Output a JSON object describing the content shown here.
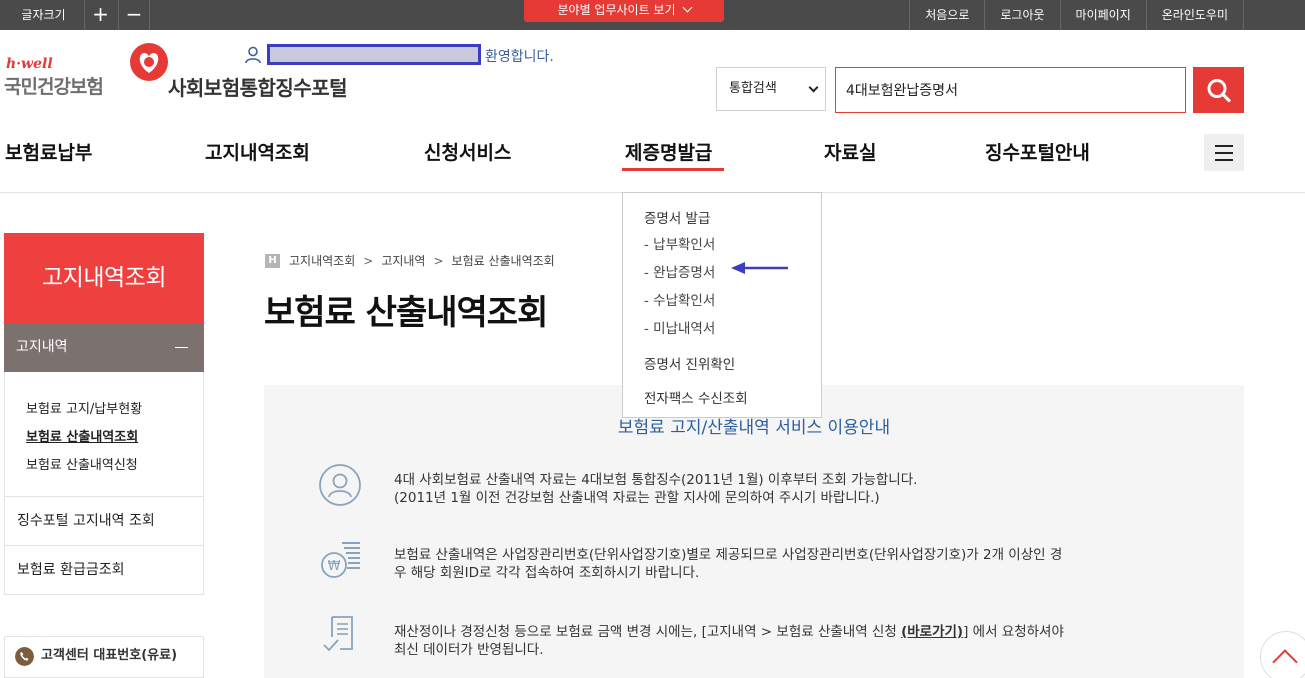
{
  "topbar": {
    "font_size_label": "글자크기",
    "font_plus": "+",
    "font_minus": "−",
    "field_site_label": "분야별 업무사이트 보기",
    "links": [
      "처음으로",
      "로그아웃",
      "마이페이지",
      "온라인도우미"
    ]
  },
  "header": {
    "logo_hwell": "h·well",
    "logo_main": "국민건강보험",
    "portal_title": "사회보험통합징수포털",
    "welcome": "환영합니다.",
    "search_select": "통합검색",
    "search_value": "4대보험완납증명서"
  },
  "gnb": [
    "보험료납부",
    "고지내역조회",
    "신청서비스",
    "제증명발급",
    "자료실",
    "징수포털안내"
  ],
  "dropdown": {
    "heading": "증명서 발급",
    "subs": [
      "- 납부확인서",
      "- 완납증명서",
      "- 수납확인서",
      "- 미납내역서"
    ],
    "item2": "증명서 진위확인",
    "item3": "전자팩스 수신조회"
  },
  "lnb": {
    "title": "고지내역조회",
    "section": "고지내역",
    "subs": [
      "보험료 고지/납부현황",
      "보험료 산출내역조회",
      "보험료 산출내역신청"
    ],
    "boxes": [
      "징수포털 고지내역 조회",
      "보험료 환급금조회"
    ],
    "cs_label": "고객센터 대표번호(유료)"
  },
  "breadcrumb": {
    "home": "H",
    "items": [
      "고지내역조회",
      "고지내역",
      "보험료 산출내역조회"
    ],
    "sep": ">"
  },
  "page_title": "보험료 산출내역조회",
  "info": {
    "title": "보험료 고지/산출내역 서비스 이용안내",
    "p1_line1": "4대 사회보험료 산출내역 자료는 4대보험 통합징수(2011년 1월) 이후부터 조회 가능합니다.",
    "p1_line2": "(2011년 1월 이전 건강보험 산출내역 자료는 관할 지사에 문의하여 주시기 바랍니다.)",
    "p2_line1": "보험료 산출내역은 사업장관리번호(단위사업장기호)별로 제공되므로 사업장관리번호(단위사업장기호)가 2개 이상인 경",
    "p2_line2": "우 해당 회원ID로 각각 접속하여 조회하시기 바랍니다.",
    "p3_line1_a": "재산정이나 경정신청 등으로 보험료 금액 변경 시에는, [고지내역 > 보험료 산출내역 신청 ",
    "p3_link": "(바로가기)",
    "p3_line1_b": "] 에서 요청하셔야",
    "p3_line2": "최신 데이터가 반영됩니다."
  },
  "colors": {
    "brand_red": "#e53a36",
    "lnb_red": "#ef4040",
    "lnb_gray": "#7b7270",
    "arrow_blue": "#3d3dbf",
    "info_title_blue": "#2c5f9e"
  }
}
